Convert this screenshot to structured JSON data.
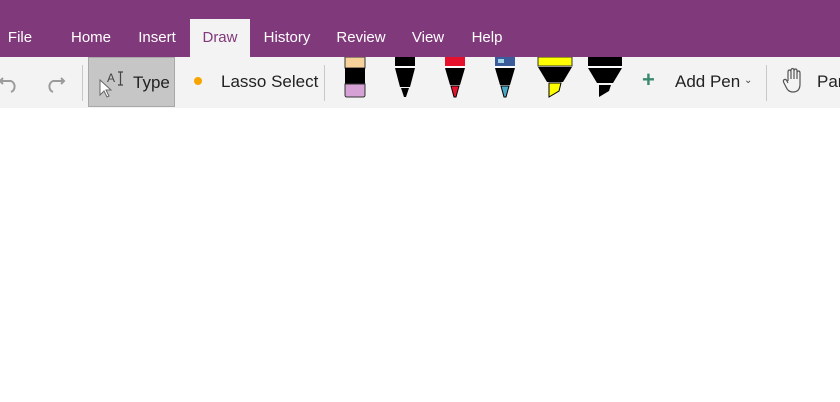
{
  "menu": {
    "tabs": [
      {
        "label": "File"
      },
      {
        "label": "Home"
      },
      {
        "label": "Insert"
      },
      {
        "label": "Draw",
        "active": true
      },
      {
        "label": "History"
      },
      {
        "label": "Review"
      },
      {
        "label": "View"
      },
      {
        "label": "Help"
      }
    ]
  },
  "ribbon": {
    "undo_icon": "undo-icon",
    "redo_icon": "redo-icon",
    "type_label": "Type",
    "lasso_label": "Lasso Select",
    "pens": [
      {
        "name": "eraser",
        "color": "#d6a2d6",
        "cap": "#f6d29a"
      },
      {
        "name": "black-pen",
        "color": "#000000"
      },
      {
        "name": "red-pen",
        "color": "#e8112d"
      },
      {
        "name": "galaxy-pen",
        "color": "#4aa9c6"
      },
      {
        "name": "yellow-highlighter",
        "color": "#ffff00"
      },
      {
        "name": "black-marker",
        "color": "#000000"
      }
    ],
    "add_pen_label": "Add Pen",
    "pan_label": "Pan"
  },
  "colors": {
    "menubar": "#80397b",
    "ribbon": "#f3f3f3",
    "accent": "#80397b"
  }
}
